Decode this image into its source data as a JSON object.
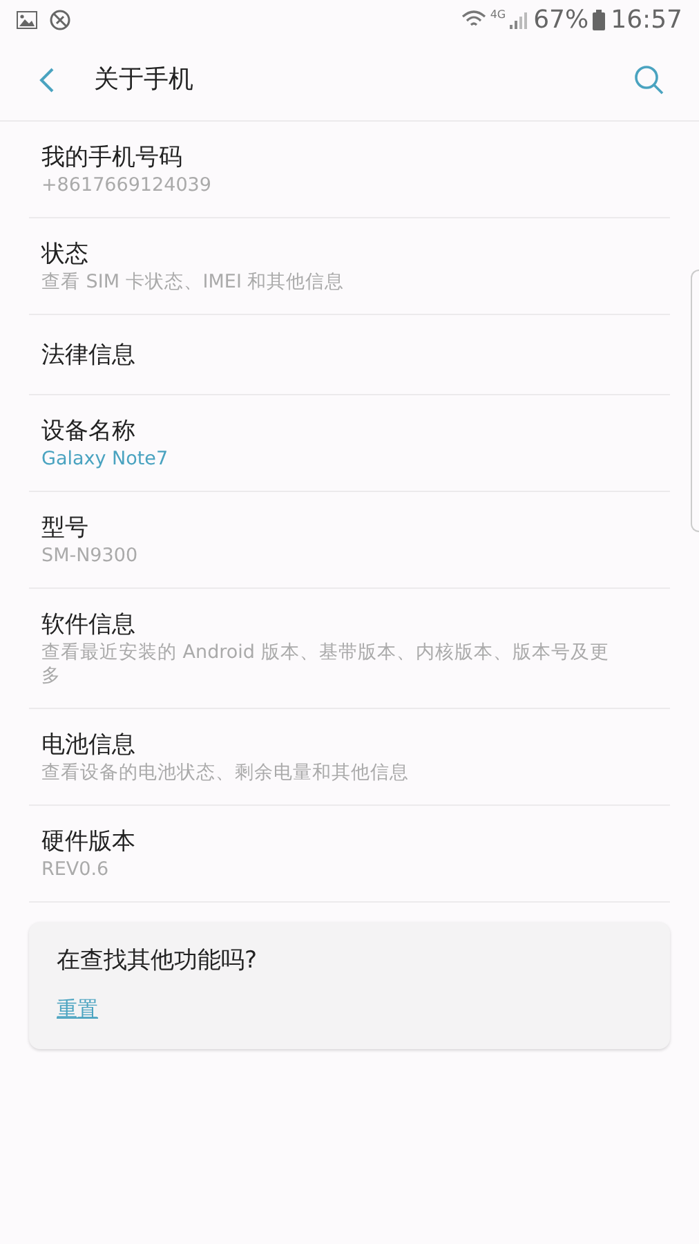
{
  "status_bar": {
    "network": "4G",
    "battery": "67%",
    "time": "16:57"
  },
  "header": {
    "title": "关于手机"
  },
  "items": [
    {
      "title": "我的手机号码",
      "subtitle": "+8617669124039",
      "accent": false
    },
    {
      "title": "状态",
      "subtitle": "查看 SIM 卡状态、IMEI 和其他信息",
      "accent": false
    },
    {
      "title": "法律信息"
    },
    {
      "title": "设备名称",
      "subtitle": "Galaxy Note7",
      "accent": true
    },
    {
      "title": "型号",
      "subtitle": "SM-N9300",
      "accent": false
    },
    {
      "title": "软件信息",
      "subtitle": "查看最近安装的 Android 版本、基带版本、内核版本、版本号及更多",
      "accent": false
    },
    {
      "title": "电池信息",
      "subtitle": "查看设备的电池状态、剩余电量和其他信息",
      "accent": false
    },
    {
      "title": "硬件版本",
      "subtitle": "REV0.6",
      "accent": false
    }
  ],
  "suggestion": {
    "question": "在查找其他功能吗?",
    "link": "重置"
  }
}
